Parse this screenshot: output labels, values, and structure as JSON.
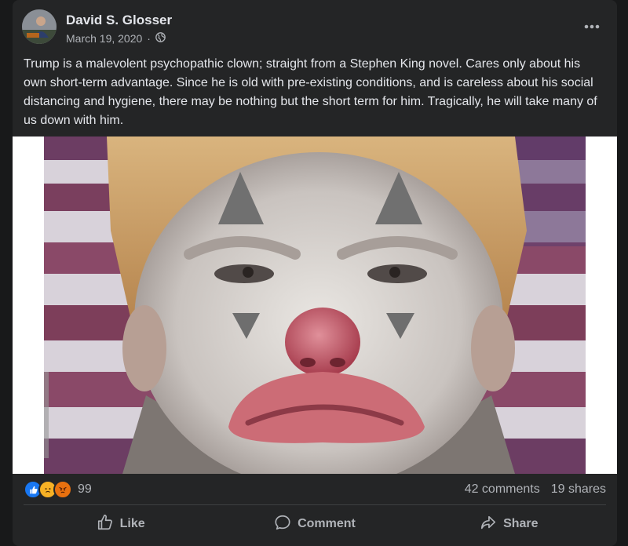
{
  "post": {
    "author": "David S. Glosser",
    "date": "March 19, 2020",
    "audience_icon": "globe-icon",
    "more_icon": "more-options-icon",
    "text": "Trump is a malevolent psychopathic clown; straight from a Stephen King novel. Cares only about his own short-term advantage. Since he is old with pre-existing conditions, and is careless about his social distancing and hygiene, there may be nothing but the short term for him. Tragically, he will take many of us down with him.",
    "image": {
      "icon": "clown-face-photo"
    }
  },
  "engagement": {
    "reaction_count": "99",
    "reactions": [
      "like-reaction-icon",
      "sad-reaction-icon",
      "angry-reaction-icon"
    ],
    "comments": "42 comments",
    "shares": "19 shares"
  },
  "actions": {
    "like": "Like",
    "comment": "Comment",
    "share": "Share"
  },
  "colors": {
    "card_bg": "#242526",
    "page_bg": "#18191a",
    "primary_text": "#e4e6eb",
    "secondary_text": "#b0b3b8",
    "like_blue": "#1877f2",
    "sad_yellow": "#f7b125",
    "angry_orange": "#e9710f"
  }
}
